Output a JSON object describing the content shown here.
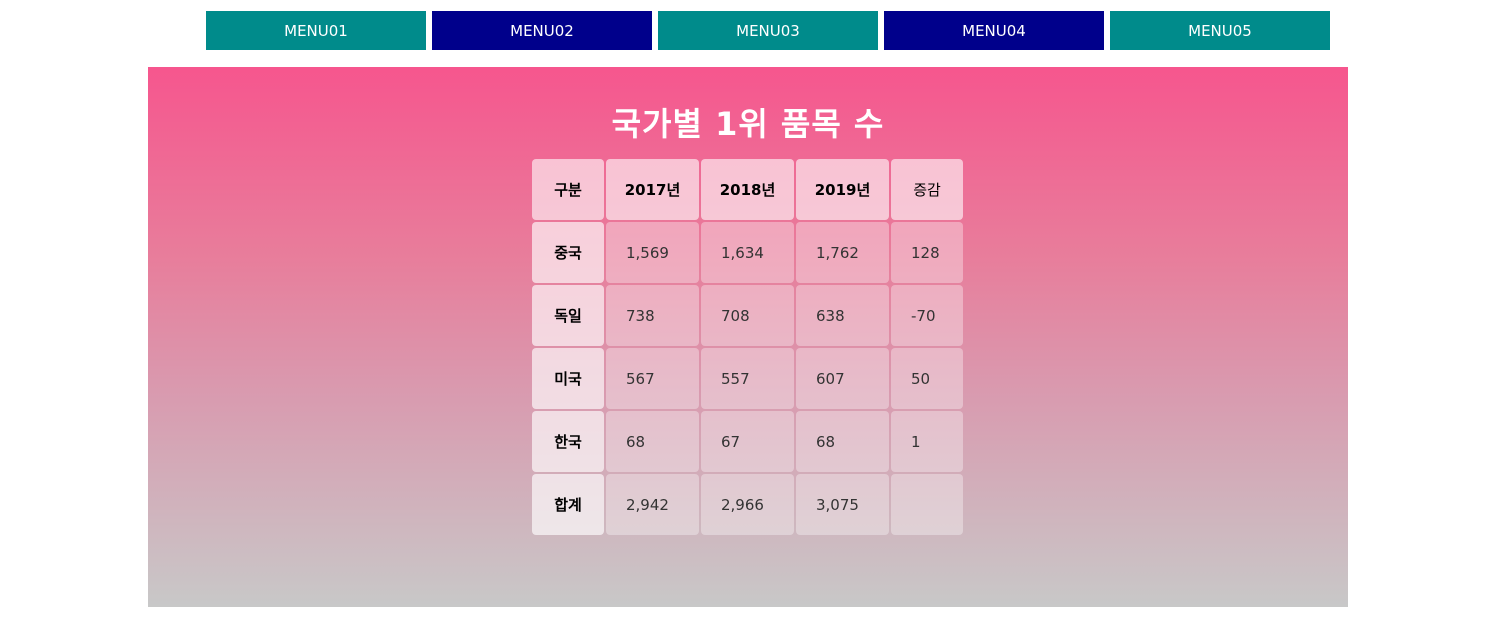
{
  "nav": {
    "items": [
      {
        "label": "MENU01",
        "color": "#008b8b"
      },
      {
        "label": "MENU02",
        "color": "#00008b"
      },
      {
        "label": "MENU03",
        "color": "#008b8b"
      },
      {
        "label": "MENU04",
        "color": "#00008b"
      },
      {
        "label": "MENU05",
        "color": "#008b8b"
      }
    ]
  },
  "title": "국가별 1위 품목 수",
  "table": {
    "headers": [
      "구분",
      "2017년",
      "2018년",
      "2019년",
      "증감"
    ],
    "rows": [
      {
        "label": "중국",
        "y2017": "1,569",
        "y2018": "1,634",
        "y2019": "1,762",
        "diff": "128"
      },
      {
        "label": "독일",
        "y2017": "738",
        "y2018": "708",
        "y2019": "638",
        "diff": "-70"
      },
      {
        "label": "미국",
        "y2017": "567",
        "y2018": "557",
        "y2019": "607",
        "diff": "50"
      },
      {
        "label": "한국",
        "y2017": "68",
        "y2018": "67",
        "y2019": "68",
        "diff": "1"
      }
    ],
    "total": {
      "label": "합계",
      "y2017": "2,942",
      "y2018": "2,966",
      "y2019": "3,075",
      "diff": ""
    }
  },
  "colors": {
    "teal": "#008b8b",
    "navy": "#00008b",
    "gradient_top": "#f6568e",
    "gradient_bottom": "#c8c8c8",
    "diff_text": "#ff1a1a",
    "total_text": "#1a1aff"
  }
}
